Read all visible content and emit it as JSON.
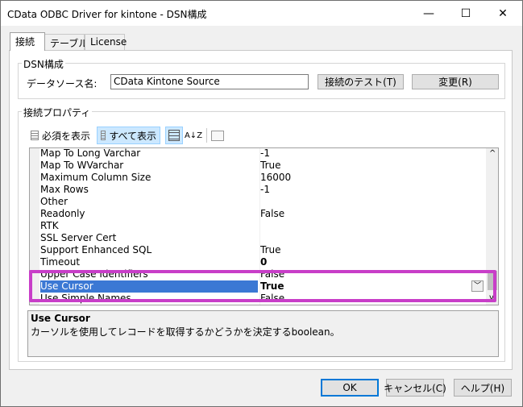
{
  "window": {
    "title": "CData ODBC Driver for kintone - DSN構成",
    "minimize": "—",
    "maximize": "☐",
    "close": "✕"
  },
  "tabs": [
    {
      "label": "接続",
      "active": true
    },
    {
      "label": "テーブル",
      "active": false
    },
    {
      "label": "License",
      "active": false
    }
  ],
  "dsn": {
    "group_label": "DSN構成",
    "name_label": "データソース名:",
    "name_value": "CData Kintone Source",
    "test_button": "接続のテスト(T)",
    "change_button": "変更(R)"
  },
  "props": {
    "group_label": "接続プロパティ",
    "required_btn": "必須を表示",
    "all_btn": "すべて表示",
    "sort_az": "A↓Z"
  },
  "grid": {
    "rows": [
      {
        "name": "Map To Long Varchar",
        "value": "-1"
      },
      {
        "name": "Map To WVarchar",
        "value": "True"
      },
      {
        "name": "Maximum Column Size",
        "value": "16000"
      },
      {
        "name": "Max Rows",
        "value": "-1"
      },
      {
        "name": "Other",
        "value": ""
      },
      {
        "name": "Readonly",
        "value": "False"
      },
      {
        "name": "RTK",
        "value": ""
      },
      {
        "name": "SSL Server Cert",
        "value": ""
      },
      {
        "name": "Support Enhanced SQL",
        "value": "True"
      },
      {
        "name": "Timeout",
        "value": "0"
      },
      {
        "name": "Upper Case Identifiers",
        "value": "False"
      },
      {
        "name": "Use Cursor",
        "value": "True"
      },
      {
        "name": "Use Simple Names",
        "value": "False"
      }
    ],
    "selected": "Use Cursor"
  },
  "description": {
    "title": "Use Cursor",
    "text": "カーソルを使用してレコードを取得するかどうかを決定するboolean。"
  },
  "footer": {
    "ok": "OK",
    "cancel": "キャンセル(C)",
    "help": "ヘルプ(H)"
  },
  "colors": {
    "highlight": "#c83ec8",
    "selection": "#3b78d4"
  }
}
